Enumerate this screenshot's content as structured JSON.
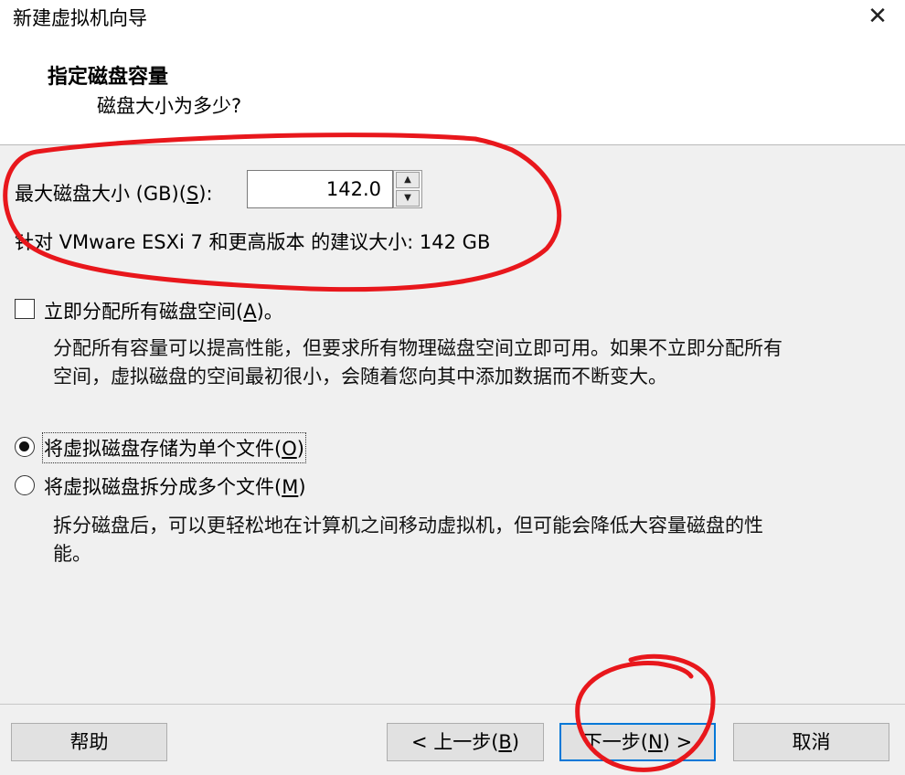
{
  "window": {
    "title": "新建虚拟机向导",
    "close_glyph": "✕"
  },
  "header": {
    "title": "指定磁盘容量",
    "subtitle": "磁盘大小为多少?"
  },
  "disk_size": {
    "label_prefix": "最大磁盘大小 (GB)(",
    "label_key": "S",
    "label_suffix": "):",
    "value": "142.0",
    "recommend_text": "针对 VMware ESXi 7 和更高版本 的建议大小: 142 GB"
  },
  "allocate": {
    "label_prefix": "立即分配所有磁盘空间(",
    "label_key": "A",
    "label_suffix": ")。",
    "checked": false,
    "desc_line1": "分配所有容量可以提高性能，但要求所有物理磁盘空间立即可用。如果不立即分配所有",
    "desc_line2": "空间，虚拟磁盘的空间最初很小，会随着您向其中添加数据而不断变大。"
  },
  "storage": {
    "single_prefix": "将虚拟磁盘存储为单个文件(",
    "single_key": "O",
    "single_suffix": ")",
    "multi_prefix": "将虚拟磁盘拆分成多个文件(",
    "multi_key": "M",
    "multi_suffix": ")",
    "selected": "single",
    "desc_line1": "拆分磁盘后，可以更轻松地在计算机之间移动虚拟机，但可能会降低大容量磁盘的性",
    "desc_line2": "能。"
  },
  "footer": {
    "help": "帮助",
    "back_prefix": "< 上一步(",
    "back_key": "B",
    "back_suffix": ")",
    "next_prefix": "下一步(",
    "next_key": "N",
    "next_suffix": ") >",
    "cancel": "取消"
  },
  "colors": {
    "annotation": "#e8171c",
    "default_button_border": "#0078d7"
  }
}
